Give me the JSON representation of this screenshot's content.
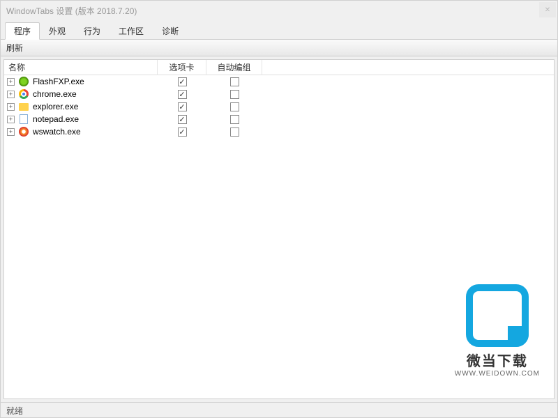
{
  "window": {
    "title": "WindowTabs 设置 (版本 2018.7.20)"
  },
  "tabs": [
    {
      "label": "程序",
      "active": true
    },
    {
      "label": "外观",
      "active": false
    },
    {
      "label": "行为",
      "active": false
    },
    {
      "label": "工作区",
      "active": false
    },
    {
      "label": "诊断",
      "active": false
    }
  ],
  "toolbar": {
    "refresh_label": "刷新"
  },
  "table": {
    "columns": {
      "name": "名称",
      "tab_card": "选项卡",
      "auto_group": "自动编组"
    },
    "rows": [
      {
        "icon": "flashfxp",
        "name": "FlashFXP.exe",
        "tab_checked": true,
        "auto_checked": false
      },
      {
        "icon": "chrome",
        "name": "chrome.exe",
        "tab_checked": true,
        "auto_checked": false
      },
      {
        "icon": "explorer",
        "name": "explorer.exe",
        "tab_checked": true,
        "auto_checked": false
      },
      {
        "icon": "notepad",
        "name": "notepad.exe",
        "tab_checked": true,
        "auto_checked": false
      },
      {
        "icon": "wswatch",
        "name": "wswatch.exe",
        "tab_checked": true,
        "auto_checked": false
      }
    ]
  },
  "statusbar": {
    "text": "就绪"
  },
  "watermark": {
    "line1": "微当下载",
    "line2": "WWW.WEIDOWN.COM"
  }
}
